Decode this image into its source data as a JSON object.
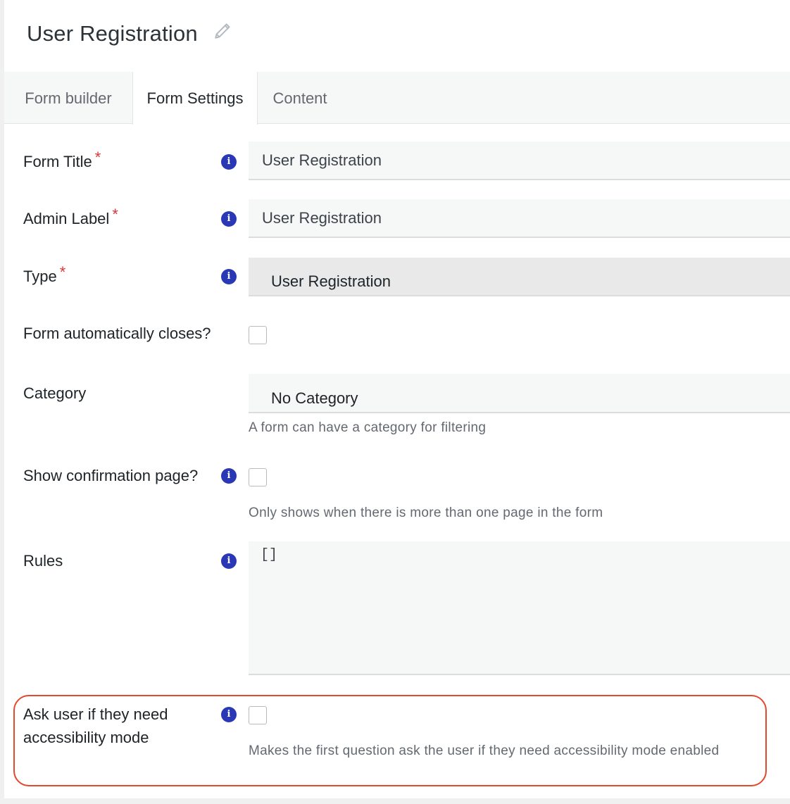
{
  "header": {
    "title": "User Registration"
  },
  "tabs": [
    {
      "label": "Form builder"
    },
    {
      "label": "Form Settings"
    },
    {
      "label": "Content"
    }
  ],
  "fields": {
    "form_title": {
      "label": "Form Title",
      "required_mark": "*",
      "value": "User Registration"
    },
    "admin_label": {
      "label": "Admin Label",
      "required_mark": "*",
      "value": "User Registration"
    },
    "type": {
      "label": "Type",
      "required_mark": "*",
      "value": "User Registration"
    },
    "auto_close": {
      "label": "Form automatically closes?",
      "checked": false
    },
    "category": {
      "label": "Category",
      "value": "No Category",
      "help": "A form can have a category for filtering"
    },
    "confirmation": {
      "label": "Show confirmation page?",
      "checked": false,
      "help": "Only shows when there is more than one page in the form"
    },
    "rules": {
      "label": "Rules",
      "value": "[]"
    },
    "accessibility": {
      "label_line1": "Ask user if they need",
      "label_line2": "accessibility mode",
      "checked": false,
      "help": "Makes the first question ask the user if they need accessibility mode enabled"
    }
  },
  "icons": {
    "info": "i"
  },
  "colors": {
    "accent": "#2b38b5",
    "required": "#d63638",
    "highlight": "#e2492b"
  }
}
